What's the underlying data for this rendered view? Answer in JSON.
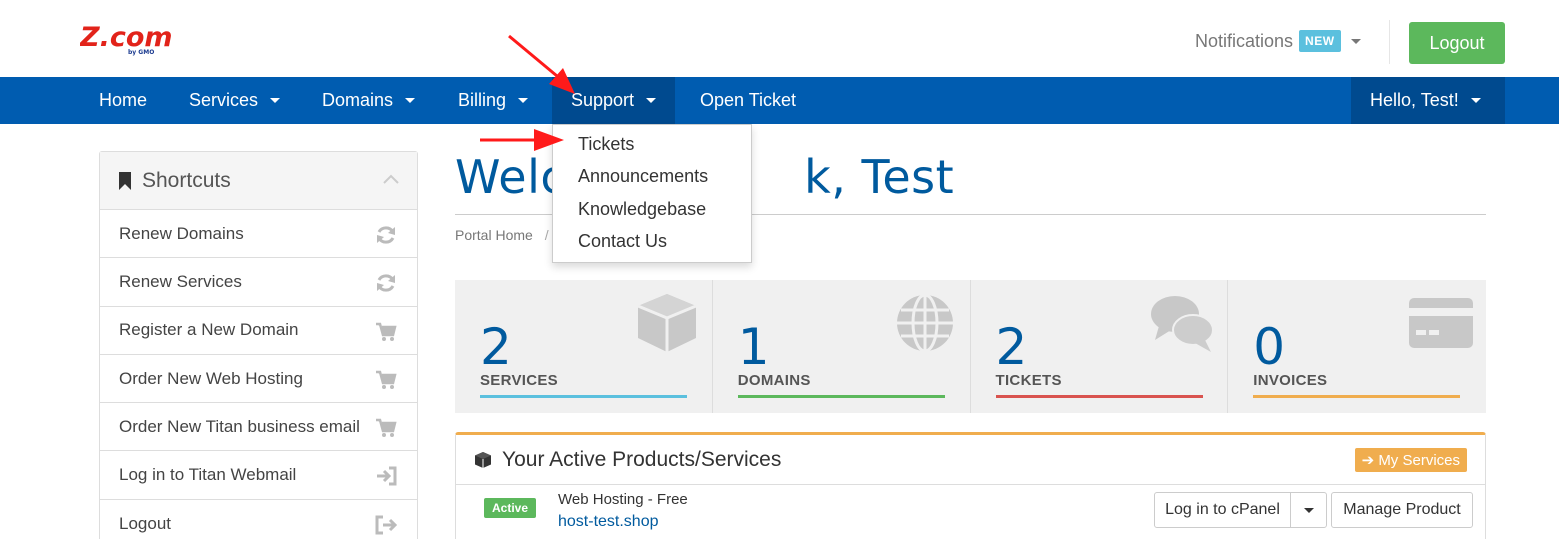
{
  "header": {
    "logo_text": "Z.com",
    "logo_sub": "by GMO",
    "notifications_label": "Notifications",
    "notifications_badge": "NEW",
    "logout_label": "Logout"
  },
  "nav": {
    "items": [
      {
        "label": "Home"
      },
      {
        "label": "Services"
      },
      {
        "label": "Domains"
      },
      {
        "label": "Billing"
      },
      {
        "label": "Support"
      },
      {
        "label": "Open Ticket"
      }
    ],
    "user_label": "Hello, Test!"
  },
  "support_dropdown": {
    "items": [
      "Tickets",
      "Announcements",
      "Knowledgebase",
      "Contact Us"
    ]
  },
  "sidebar": {
    "title": "Shortcuts",
    "items": [
      {
        "label": "Renew Domains",
        "icon": "refresh-icon"
      },
      {
        "label": "Renew Services",
        "icon": "refresh-icon"
      },
      {
        "label": "Register a New Domain",
        "icon": "cart-icon"
      },
      {
        "label": "Order New Web Hosting",
        "icon": "cart-icon"
      },
      {
        "label": "Order New Titan business email",
        "icon": "cart-icon"
      },
      {
        "label": "Log in to Titan Webmail",
        "icon": "sign-in-icon"
      },
      {
        "label": "Logout",
        "icon": "sign-out-icon"
      }
    ]
  },
  "main": {
    "welcome_left": "Welc",
    "welcome_right": "k, Test",
    "breadcrumb_home": "Portal Home",
    "breadcrumb_sep": "/"
  },
  "tiles": [
    {
      "count": "2",
      "label": "SERVICES",
      "color": "#5bc0de",
      "icon": "cube-icon"
    },
    {
      "count": "1",
      "label": "DOMAINS",
      "color": "#5cb85c",
      "icon": "globe-icon"
    },
    {
      "count": "2",
      "label": "TICKETS",
      "color": "#d9534f",
      "icon": "comments-icon"
    },
    {
      "count": "0",
      "label": "INVOICES",
      "color": "#f0ad4e",
      "icon": "credit-card-icon"
    }
  ],
  "products_panel": {
    "title": "Your Active Products/Services",
    "my_services_label": "My Services",
    "rows": [
      {
        "status": "Active",
        "product": "Web Hosting - Free",
        "domain": "host-test.shop",
        "login_label": "Log in to cPanel",
        "manage_label": "Manage Product"
      }
    ]
  },
  "colors": {
    "navbar": "#005cb0",
    "navbar_active": "#004a8f",
    "logout_green": "#5cb85c",
    "accent_orange": "#f0ad4e",
    "heading_blue": "#005a9e",
    "arrow_red": "#ff1a1a"
  }
}
